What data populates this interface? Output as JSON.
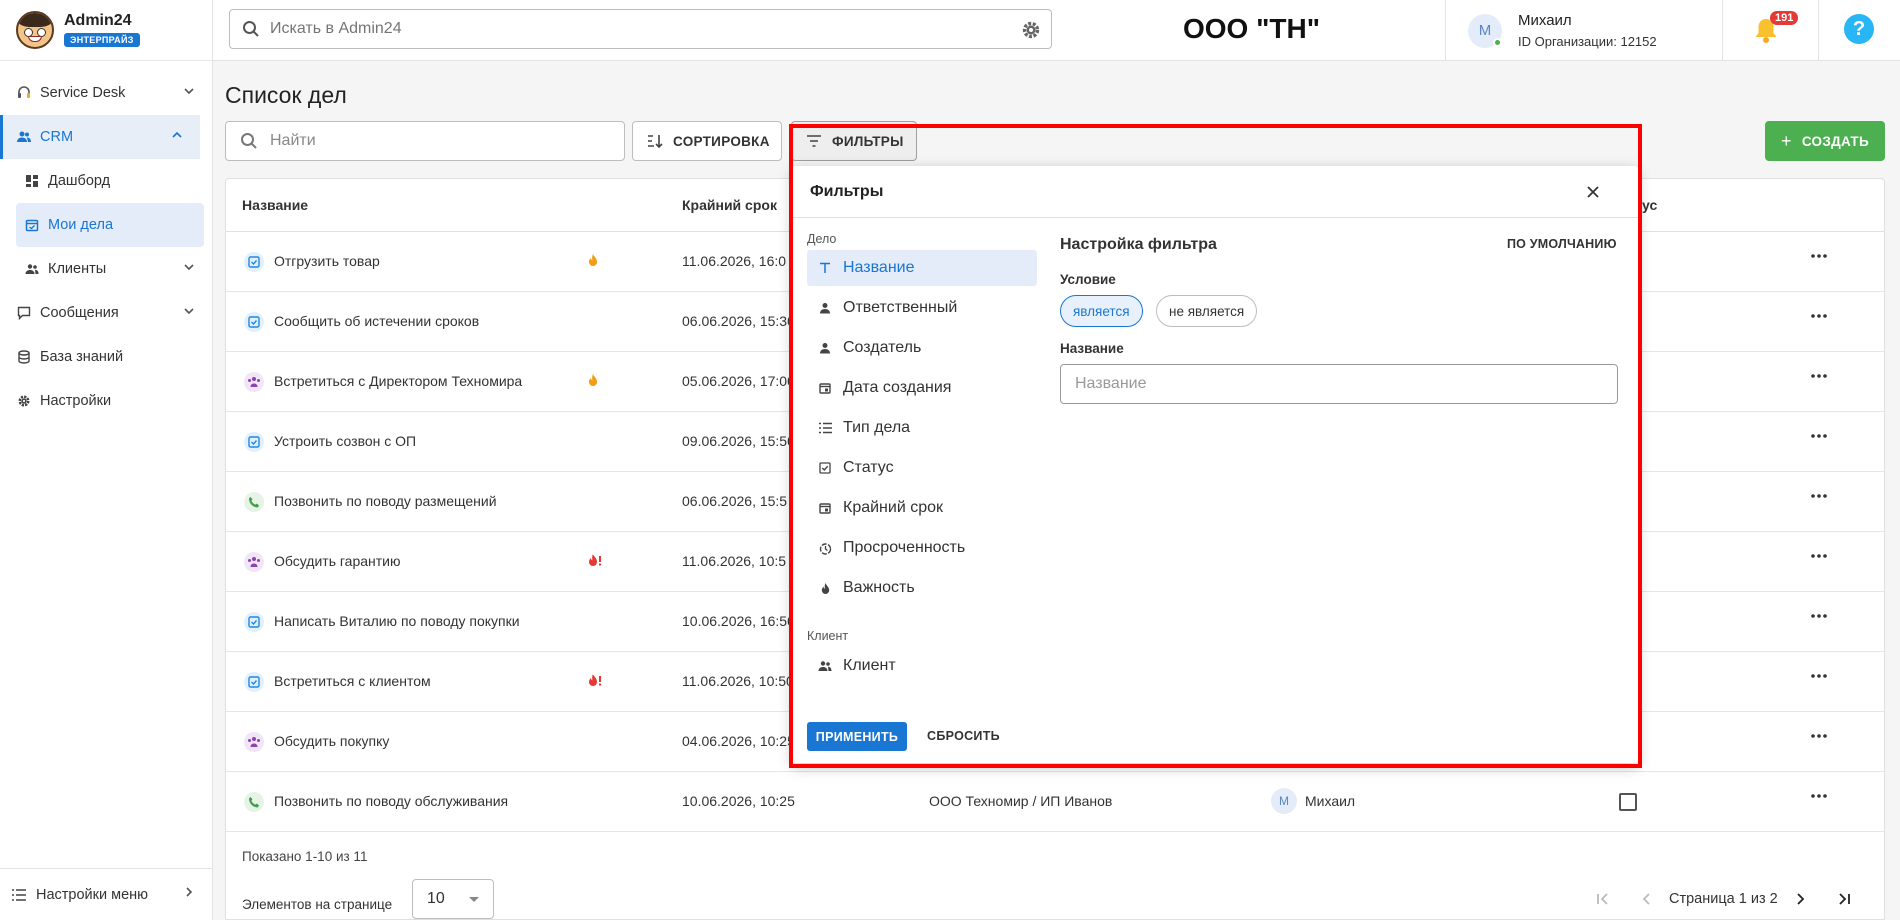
{
  "brand": {
    "name": "Admin24",
    "badge": "ЭНТЕРПРАЙЗ"
  },
  "sidebar": {
    "items": [
      {
        "label": "Service Desk",
        "icon": "headset-icon"
      },
      {
        "label": "CRM",
        "icon": "users-icon"
      },
      {
        "label": "Дашборд",
        "icon": "dashboard-icon"
      },
      {
        "label": "Мои дела",
        "icon": "calendar-check-icon"
      },
      {
        "label": "Клиенты",
        "icon": "clients-icon"
      },
      {
        "label": "Сообщения",
        "icon": "chat-icon"
      },
      {
        "label": "База знаний",
        "icon": "database-icon"
      },
      {
        "label": "Настройки",
        "icon": "gear-icon"
      }
    ],
    "footer_label": "Настройки меню"
  },
  "topbar": {
    "search_placeholder": "Искать в Admin24",
    "org_name": "ООО \"ТН\"",
    "user": {
      "initial": "М",
      "name": "Михаил",
      "org_id": "ID Организации: 12152"
    },
    "notifications_count": "191",
    "help_label": "?"
  },
  "main": {
    "title": "Список дел",
    "search_placeholder": "Найти",
    "sort_label": "СОРТИРОВКА",
    "filter_label": "ФИЛЬТРЫ",
    "create_label": "СОЗДАТЬ"
  },
  "table": {
    "headers": {
      "name": "Название",
      "deadline": "Крайний срок",
      "status_suffix": "ус"
    },
    "rows": [
      {
        "type": "task",
        "name": "Отгрузить товар",
        "fire": "fire",
        "deadline": "11.06.2026, 16:0"
      },
      {
        "type": "task",
        "name": "Сообщить об истечении сроков",
        "fire": "",
        "deadline": "06.06.2026, 15:30"
      },
      {
        "type": "meeting",
        "name": "Встретиться с Директором Техномира",
        "fire": "fire",
        "deadline": "05.06.2026, 17:00"
      },
      {
        "type": "task",
        "name": "Устроить созвон с ОП",
        "fire": "",
        "deadline": "09.06.2026, 15:50"
      },
      {
        "type": "call",
        "name": "Позвонить по поводу размещений",
        "fire": "",
        "deadline": "06.06.2026, 15:5"
      },
      {
        "type": "meeting",
        "name": "Обсудить гарантию",
        "fire": "urgent",
        "deadline": "11.06.2026, 10:5"
      },
      {
        "type": "task",
        "name": "Написать Виталию по поводу покупки",
        "fire": "",
        "deadline": "10.06.2026, 16:50"
      },
      {
        "type": "task",
        "name": "Встретиться с клиентом",
        "fire": "urgent",
        "deadline": "11.06.2026, 10:50"
      },
      {
        "type": "meeting",
        "name": "Обсудить покупку",
        "fire": "",
        "deadline": "04.06.2026, 10:25"
      },
      {
        "type": "call",
        "name": "Позвонить по поводу обслуживания",
        "fire": "",
        "deadline": "10.06.2026, 10:25",
        "client": "ООО Техномир / ИП Иванов",
        "responsible": "Михаил",
        "responsible_initial": "М"
      }
    ],
    "shown_text": "Показано 1-10 из 11",
    "per_page_label": "Элементов на странице",
    "per_page_value": "10",
    "page_text": "Страница 1 из 2"
  },
  "filter_panel": {
    "title": "Фильтры",
    "group_deal": "Дело",
    "items": [
      {
        "label": "Название",
        "icon": "text-icon"
      },
      {
        "label": "Ответственный",
        "icon": "person-icon"
      },
      {
        "label": "Создатель",
        "icon": "person-icon"
      },
      {
        "label": "Дата создания",
        "icon": "calendar-icon"
      },
      {
        "label": "Тип дела",
        "icon": "list-icon"
      },
      {
        "label": "Статус",
        "icon": "checkbox-icon"
      },
      {
        "label": "Крайний срок",
        "icon": "calendar-icon"
      },
      {
        "label": "Просроченность",
        "icon": "timer-icon"
      },
      {
        "label": "Важность",
        "icon": "fire-icon"
      }
    ],
    "group_client": "Клиент",
    "client_item": "Клиент",
    "settings_title": "Настройка фильтра",
    "default_label": "ПО УМОЛЧАНИЮ",
    "condition_label": "Условие",
    "chip_is": "является",
    "chip_is_not": "не является",
    "name_label": "Название",
    "name_placeholder": "Название",
    "apply_label": "ПРИМЕНИТЬ",
    "reset_label": "СБРОСИТЬ"
  },
  "colors": {
    "accent": "#1976d2",
    "create": "#4caf50",
    "highlight": "#ff0000",
    "badge": "#e53935"
  }
}
